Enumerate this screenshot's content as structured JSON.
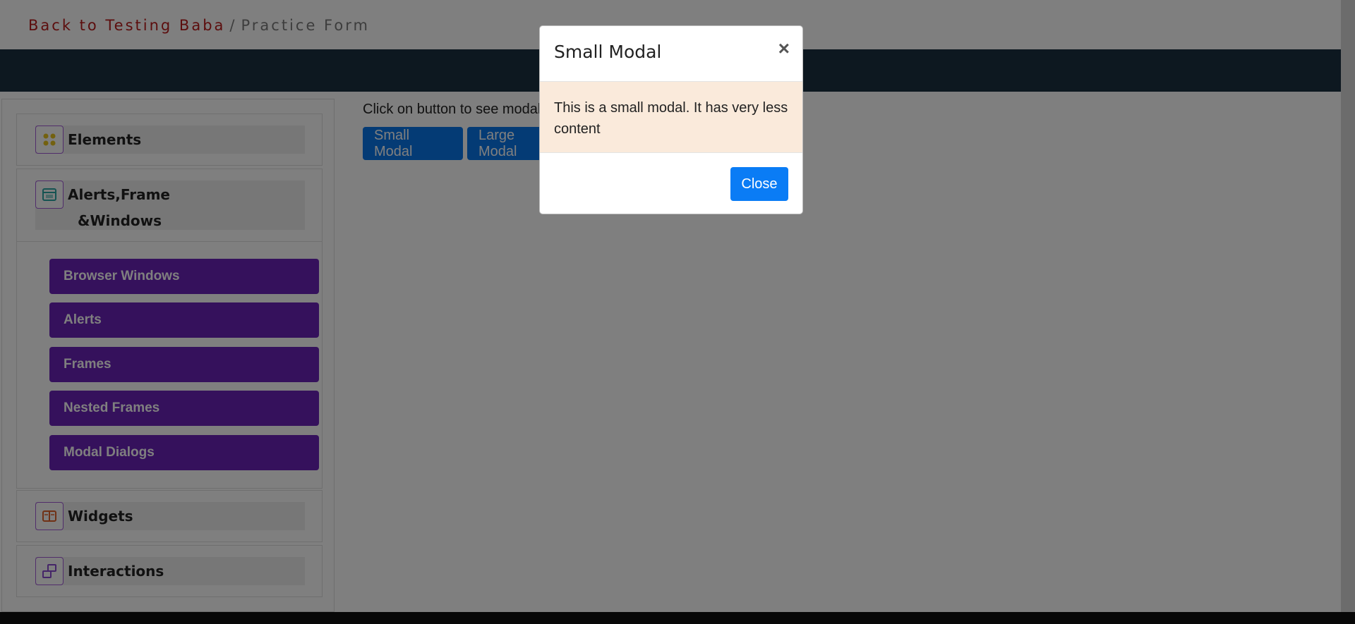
{
  "breadcrumb": {
    "link": "Back to Testing Baba",
    "separator": "/",
    "current": "Practice Form"
  },
  "sidebar": {
    "groups": [
      {
        "title": "Elements",
        "icon": "elements-icon"
      },
      {
        "title_line1": "Alerts,Frame",
        "title_line2": "&Windows",
        "icon": "window-icon"
      },
      {
        "title": "Widgets",
        "icon": "widgets-icon"
      },
      {
        "title": "Interactions",
        "icon": "interactions-icon"
      }
    ],
    "items": [
      {
        "label": "Browser Windows"
      },
      {
        "label": "Alerts"
      },
      {
        "label": "Frames"
      },
      {
        "label": "Nested Frames"
      },
      {
        "label": "Modal Dialogs"
      }
    ]
  },
  "main": {
    "hint": "Click on button to see modal",
    "small_modal_label": "Small Modal",
    "large_modal_label": "Large Modal"
  },
  "modal": {
    "title": "Small Modal",
    "close_x": "×",
    "body": "This is a small modal. It has very less content",
    "close_label": "Close"
  },
  "colors": {
    "breadcrumb_link": "#b81c1c",
    "nav_band": "#1b3040",
    "menu_button": "#6b23b8",
    "primary_button": "#0876ea",
    "modal_body_bg": "#faeadb"
  }
}
